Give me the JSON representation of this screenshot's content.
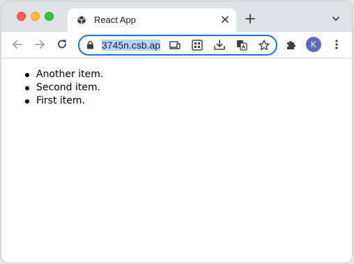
{
  "tab": {
    "title": "React App",
    "favicon": "codesandbox-cube-icon"
  },
  "address_bar": {
    "url": "3745n.csb.ap",
    "secure": true
  },
  "profile": {
    "initial": "K",
    "color": "#5c6bc0"
  },
  "toolbar_icons": [
    "back-icon",
    "forward-icon",
    "reload-icon",
    "cast-icon",
    "apps-icon",
    "install-icon",
    "translate-icon",
    "bookmark-star-icon",
    "extensions-icon",
    "menu-icon"
  ],
  "content": {
    "items": [
      "Another item.",
      "Second item.",
      "First item."
    ]
  }
}
